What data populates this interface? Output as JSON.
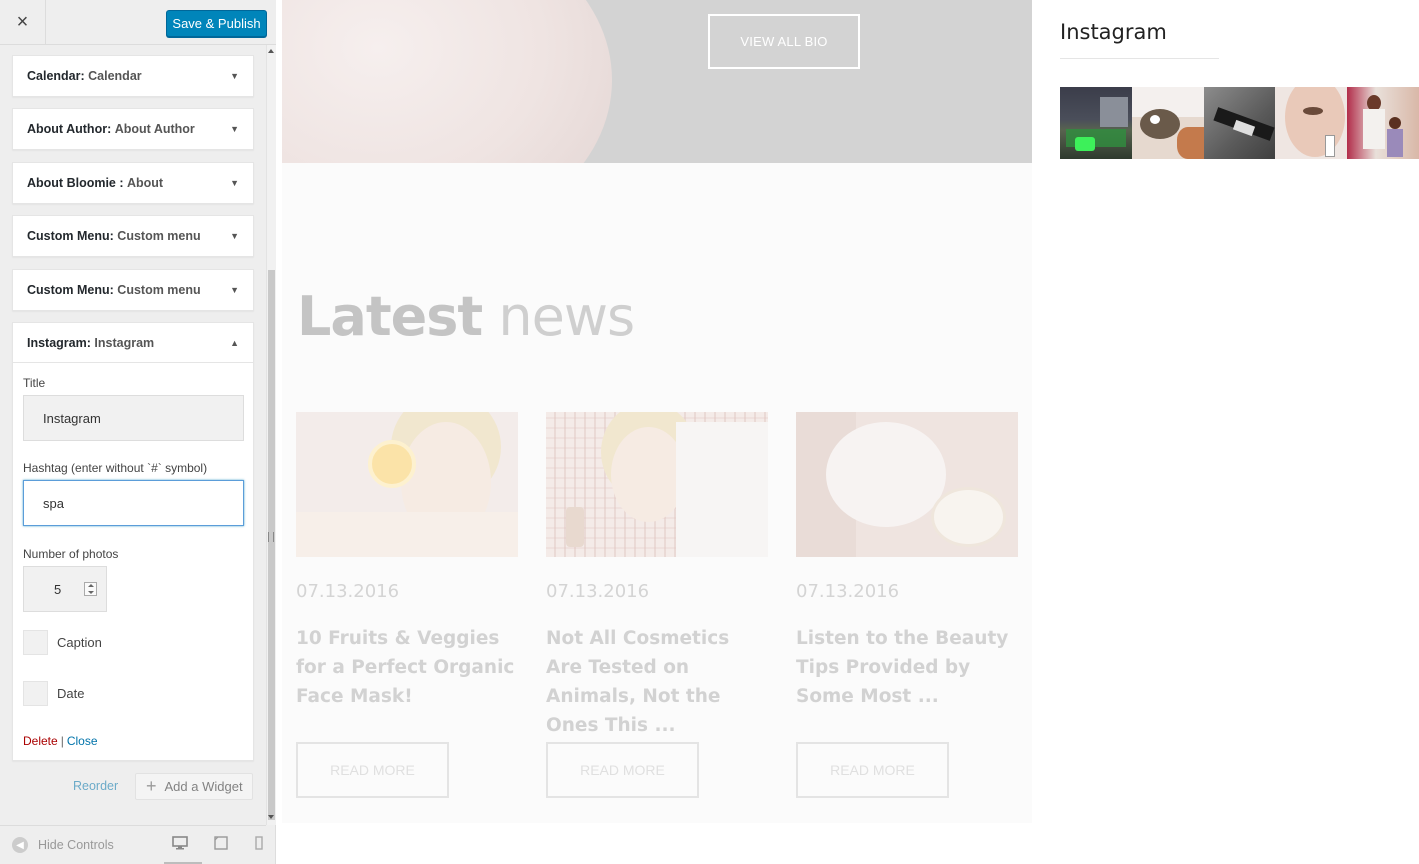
{
  "sidebar": {
    "close_icon": "×",
    "publish_label": "Save & Publish",
    "widgets": [
      {
        "type": "Calendar:",
        "name": "Calendar"
      },
      {
        "type": "About Author:",
        "name": "About Author"
      },
      {
        "type": "About Bloomie :",
        "name": "About"
      },
      {
        "type": "Custom Menu:",
        "name": "Custom menu"
      },
      {
        "type": "Custom Menu:",
        "name": "Custom menu"
      },
      {
        "type": "Instagram:",
        "name": "Instagram"
      }
    ],
    "instagram_form": {
      "title_label": "Title",
      "title_value": "Instagram",
      "hashtag_label": "Hashtag (enter without `#` symbol)",
      "hashtag_value": "spa",
      "photos_label": "Number of photos",
      "photos_value": "5",
      "caption_label": "Caption",
      "date_label": "Date",
      "delete_label": "Delete",
      "separator": "|",
      "close_label": "Close"
    },
    "reorder_label": "Reorder",
    "add_widget_label": "Add a Widget",
    "hide_controls_label": "Hide Controls",
    "colors": {
      "publish_bg": "#0085ba",
      "link": "#0073aa",
      "delete": "#aa0000"
    }
  },
  "preview": {
    "view_bio_label": "VIEW ALL BIO",
    "news_heading_bold": "Latest",
    "news_heading_light": "news",
    "posts": [
      {
        "date": "07.13.2016",
        "title": "10 Fruits & Veggies for a Perfect Organic Face Mask!",
        "button": "READ MORE"
      },
      {
        "date": "07.13.2016",
        "title": "Not All Cosmetics Are Tested on Animals, Not the Ones This ...",
        "button": "READ MORE"
      },
      {
        "date": "07.13.2016",
        "title": "Listen to the Beauty Tips Provided by Some Most ...",
        "button": "READ MORE"
      }
    ],
    "instagram": {
      "title": "Instagram",
      "photos": [
        "instagram-photo-spa-equipment",
        "instagram-photo-face-mask",
        "instagram-photo-device",
        "instagram-photo-woman-face",
        "instagram-photo-therapists"
      ]
    }
  }
}
